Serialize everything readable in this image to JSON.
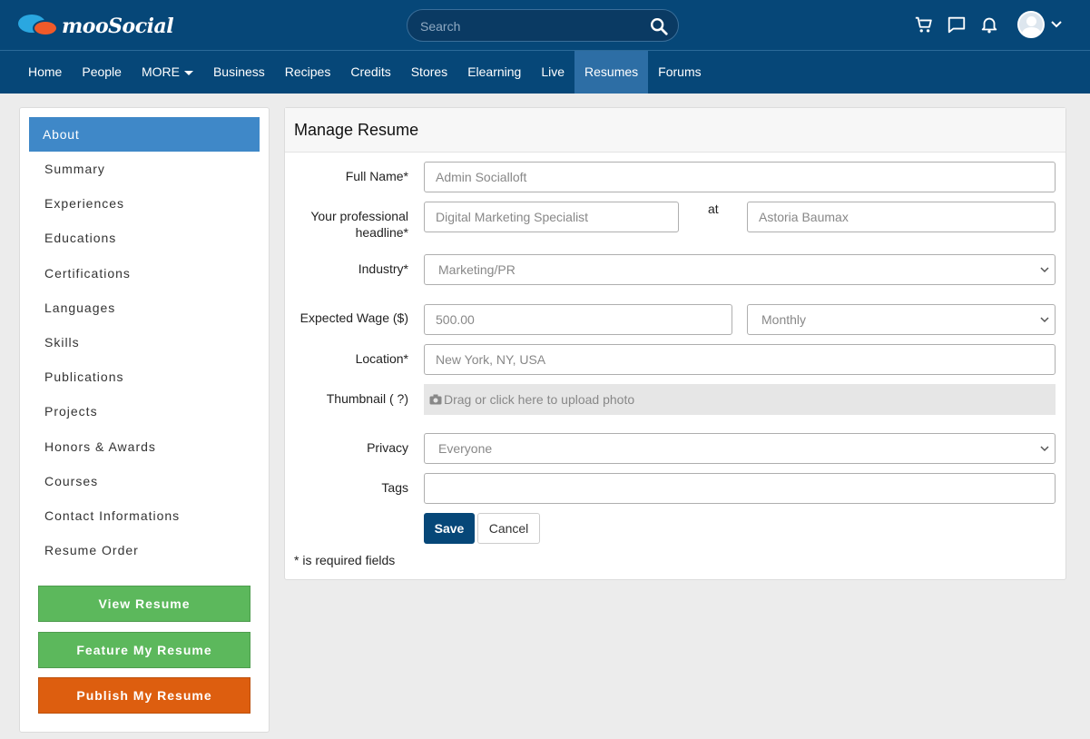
{
  "header": {
    "brand": "mooSocial",
    "search_placeholder": "Search"
  },
  "nav": {
    "items": [
      "Home",
      "People",
      "MORE",
      "Business",
      "Recipes",
      "Credits",
      "Stores",
      "Elearning",
      "Live",
      "Resumes",
      "Forums"
    ],
    "active": "Resumes"
  },
  "sidebar": {
    "active_item": "About",
    "items": [
      "Summary",
      "Experiences",
      "Educations",
      "Certifications",
      "Languages",
      "Skills",
      "Publications",
      "Projects",
      "Honors & Awards",
      "Courses",
      "Contact Informations",
      "Resume Order"
    ],
    "buttons": {
      "view": "View Resume",
      "feature": "Feature My Resume",
      "publish": "Publish My Resume"
    }
  },
  "form": {
    "title": "Manage Resume",
    "full_name": {
      "label": "Full Name*",
      "placeholder": "Admin Socialloft"
    },
    "headline": {
      "label_line1": "Your professional",
      "label_line2": "headline*",
      "placeholder": "Digital Marketing Specialist",
      "at": "at",
      "company_placeholder": "Astoria Baumax"
    },
    "industry": {
      "label": "Industry*",
      "value": "Marketing/PR"
    },
    "wage": {
      "label": "Expected Wage ($)",
      "placeholder": "500.00",
      "period": "Monthly"
    },
    "location": {
      "label": "Location*",
      "placeholder": "New York, NY, USA"
    },
    "thumbnail": {
      "label": "Thumbnail ( ?)",
      "upload_text": "Drag or click here to upload photo"
    },
    "privacy": {
      "label": "Privacy",
      "value": "Everyone"
    },
    "tags": {
      "label": "Tags",
      "value": ""
    },
    "save": "Save",
    "cancel": "Cancel",
    "required_note": "* is required fields"
  },
  "colors": {
    "header_bg": "#064778",
    "nav_active": "#2d6ea5",
    "sidebar_active": "#3f88c8",
    "btn_green": "#5cb85c",
    "btn_orange": "#dd5e0f"
  }
}
